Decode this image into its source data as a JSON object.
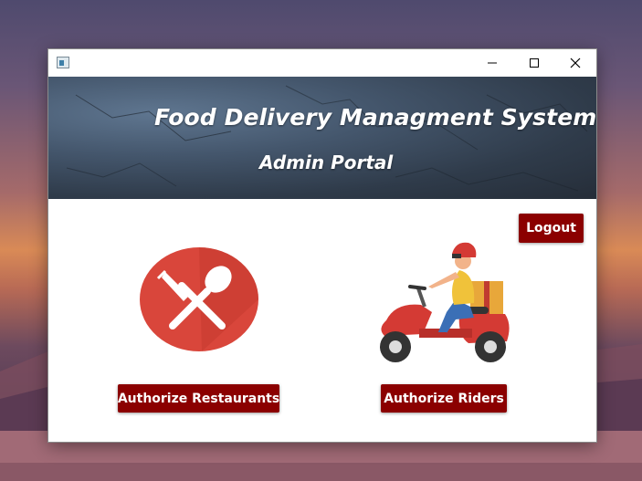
{
  "window": {
    "icon": "app-icon"
  },
  "header": {
    "title": "Food Delivery Managment System",
    "subtitle": "Admin Portal"
  },
  "actions": {
    "logout_label": "Logout",
    "authorize_restaurants_label": "Authorize Restaurants",
    "authorize_riders_label": "Authorize Riders"
  },
  "icons": {
    "restaurant": "fork-spoon-icon",
    "rider": "delivery-scooter-illustration"
  },
  "colors": {
    "button": "#8b0000",
    "restaurant_icon": "#d9463b",
    "header_bg": "#3a4a5c"
  }
}
